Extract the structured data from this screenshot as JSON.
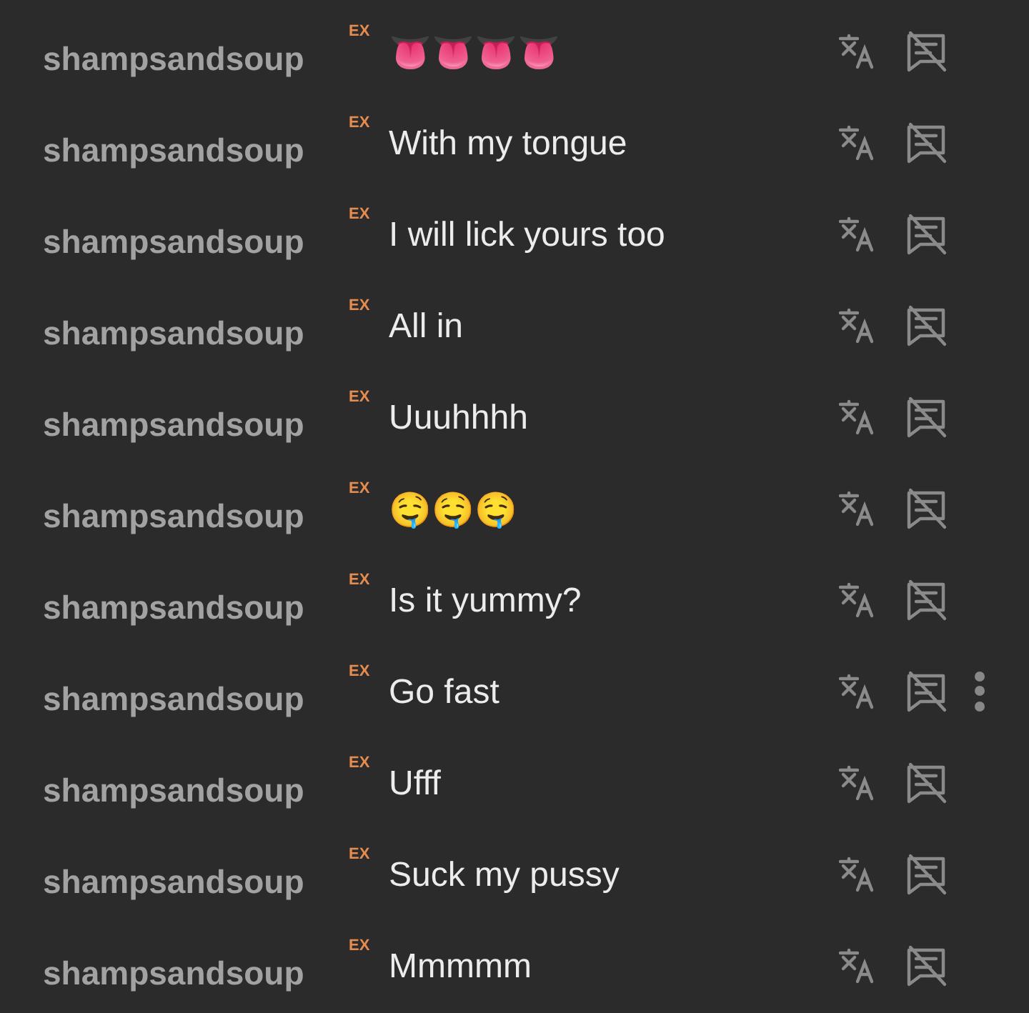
{
  "messages": [
    {
      "username": "shampsandsoup",
      "badge": "EX",
      "text": "👅👅👅👅",
      "menu_shown": false
    },
    {
      "username": "shampsandsoup",
      "badge": "EX",
      "text": "With my tongue",
      "menu_shown": false
    },
    {
      "username": "shampsandsoup",
      "badge": "EX",
      "text": "I will lick yours too",
      "menu_shown": false
    },
    {
      "username": "shampsandsoup",
      "badge": "EX",
      "text": "All in",
      "menu_shown": false
    },
    {
      "username": "shampsandsoup",
      "badge": "EX",
      "text": "Uuuhhhh",
      "menu_shown": false
    },
    {
      "username": "shampsandsoup",
      "badge": "EX",
      "text": "🤤🤤🤤",
      "menu_shown": false
    },
    {
      "username": "shampsandsoup",
      "badge": "EX",
      "text": "Is it yummy?",
      "menu_shown": false
    },
    {
      "username": "shampsandsoup",
      "badge": "EX",
      "text": "Go fast",
      "menu_shown": true
    },
    {
      "username": "shampsandsoup",
      "badge": "EX",
      "text": "Ufff",
      "menu_shown": false
    },
    {
      "username": "shampsandsoup",
      "badge": "EX",
      "text": "Suck my pussy",
      "menu_shown": false
    },
    {
      "username": "shampsandsoup",
      "badge": "EX",
      "text": "Mmmmm",
      "menu_shown": false
    }
  ]
}
